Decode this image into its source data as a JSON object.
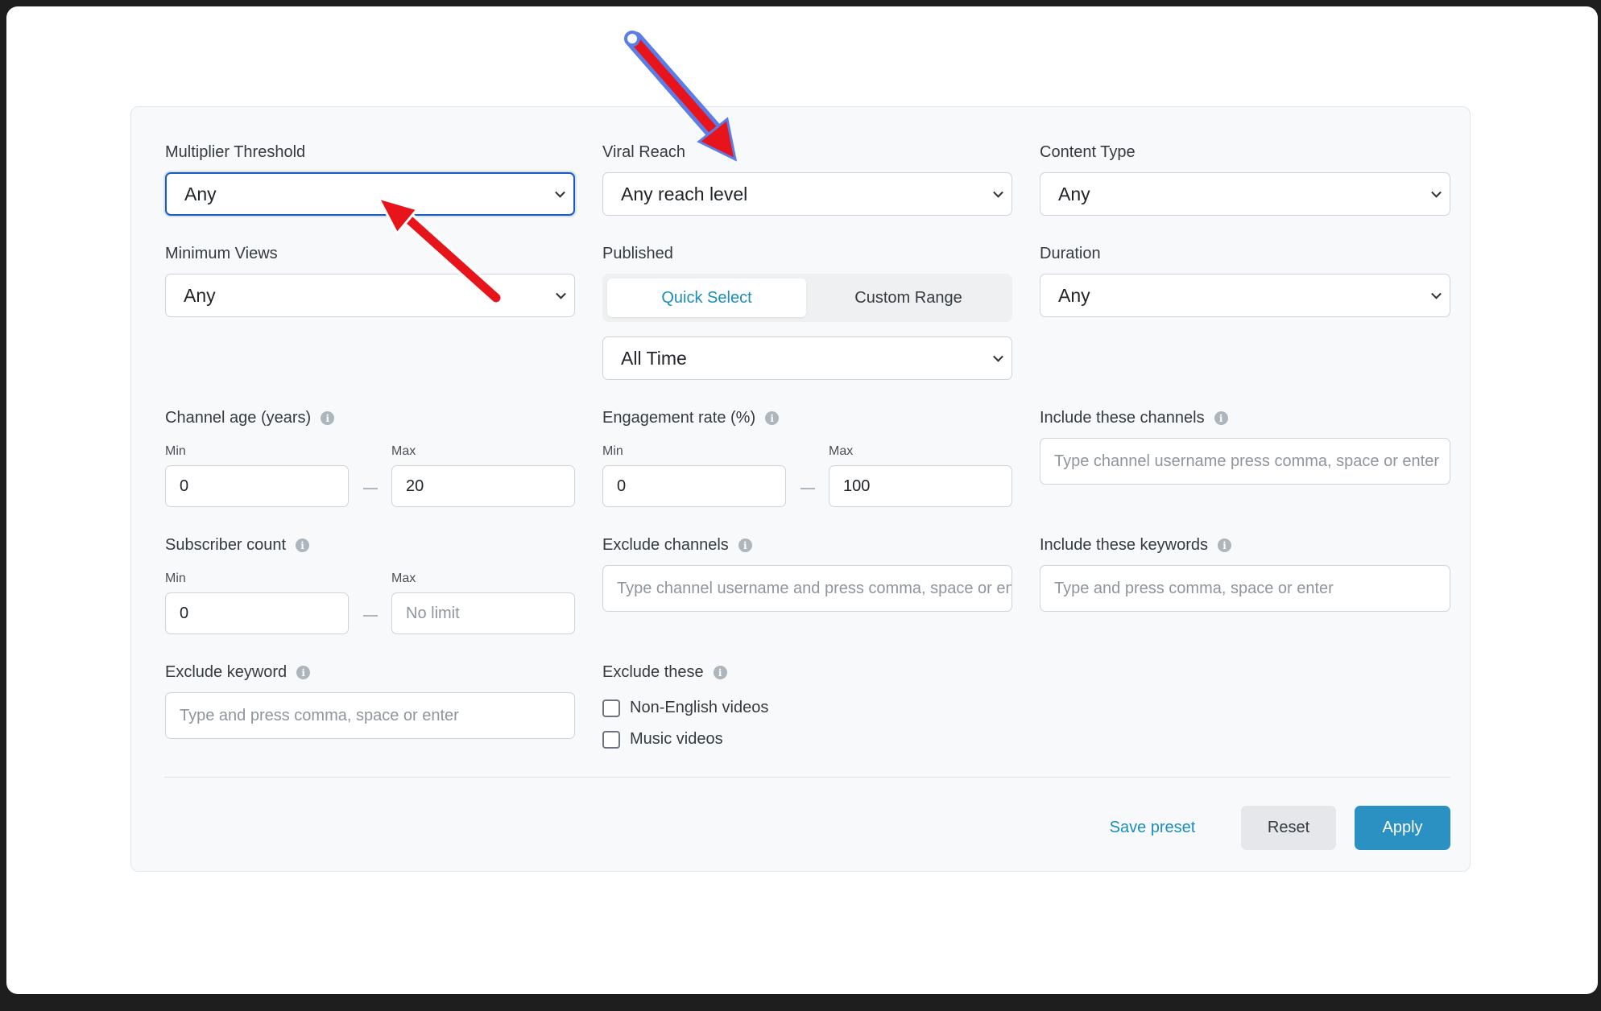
{
  "filters": {
    "multiplier": {
      "label": "Multiplier Threshold",
      "value": "Any"
    },
    "viral_reach": {
      "label": "Viral Reach",
      "value": "Any reach level"
    },
    "content_type": {
      "label": "Content Type",
      "value": "Any"
    },
    "min_views": {
      "label": "Minimum Views",
      "value": "Any"
    },
    "published": {
      "label": "Published",
      "tab_quick": "Quick Select",
      "tab_custom": "Custom Range",
      "value": "All Time"
    },
    "duration": {
      "label": "Duration",
      "value": "Any"
    },
    "channel_age": {
      "label": "Channel age (years)",
      "min_label": "Min",
      "max_label": "Max",
      "min": "0",
      "max": "20"
    },
    "engagement": {
      "label": "Engagement rate (%)",
      "min_label": "Min",
      "max_label": "Max",
      "min": "0",
      "max": "100"
    },
    "include_channels": {
      "label": "Include these channels",
      "placeholder": "Type channel username press comma, space or enter"
    },
    "subscribers": {
      "label": "Subscriber count",
      "min_label": "Min",
      "max_label": "Max",
      "min": "0",
      "max_placeholder": "No limit"
    },
    "exclude_channels": {
      "label": "Exclude channels",
      "placeholder": "Type channel username and press comma, space or enter"
    },
    "include_keywords": {
      "label": "Include these keywords",
      "placeholder": "Type and press comma, space or enter"
    },
    "exclude_keyword": {
      "label": "Exclude keyword",
      "placeholder": "Type and press comma, space or enter"
    },
    "exclude_these": {
      "label": "Exclude these",
      "opt1": "Non-English videos",
      "opt2": "Music videos"
    }
  },
  "actions": {
    "save": "Save preset",
    "reset": "Reset",
    "apply": "Apply"
  },
  "icons": {
    "info": "info-icon",
    "chevron": "chevron-down-icon",
    "annotation": "red-arrow-annotation"
  },
  "colors": {
    "accent": "#1a8dbf",
    "apply_bg": "#2b91c3",
    "focus": "#1a5cbf",
    "annotation": "#e8141c"
  }
}
